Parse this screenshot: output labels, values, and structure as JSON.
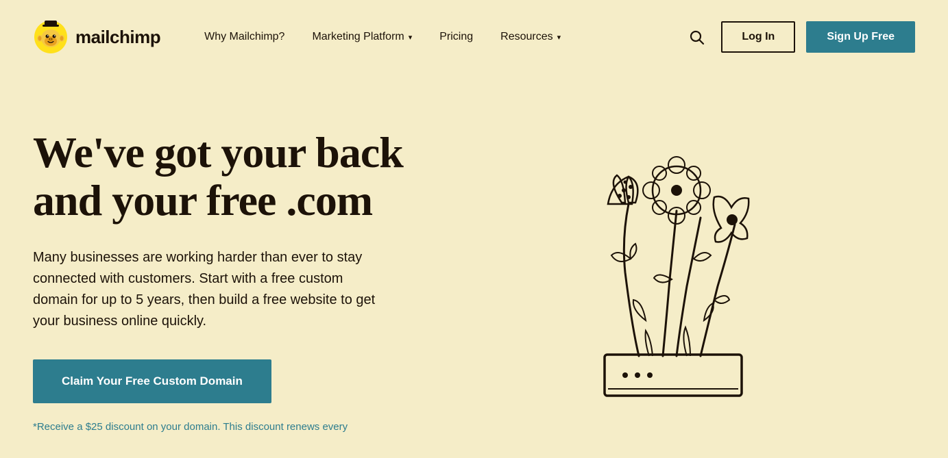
{
  "logo": {
    "text": "mailchimp",
    "alt": "Mailchimp"
  },
  "nav": {
    "items": [
      {
        "label": "Why Mailchimp?",
        "hasDropdown": false
      },
      {
        "label": "Marketing Platform",
        "hasDropdown": true
      },
      {
        "label": "Pricing",
        "hasDropdown": false
      },
      {
        "label": "Resources",
        "hasDropdown": true
      }
    ]
  },
  "header": {
    "login_label": "Log In",
    "signup_label": "Sign Up Free",
    "search_placeholder": "Search"
  },
  "hero": {
    "title_line1": "We've got your back",
    "title_line2": "and your free .com",
    "body": "Many businesses are working harder than ever to stay connected with customers. Start with a free custom domain for up to 5 years, then build a free website to get your business online quickly.",
    "cta_label": "Claim Your Free Custom Domain",
    "disclaimer": "*Receive a $25 discount on your domain. This discount renews every"
  }
}
